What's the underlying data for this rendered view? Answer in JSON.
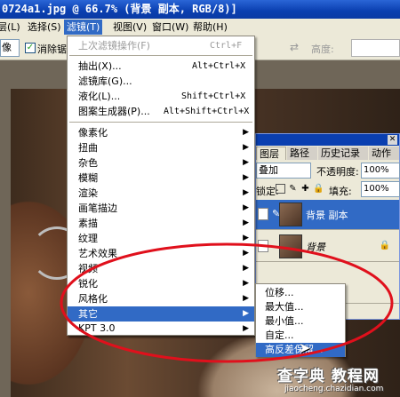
{
  "window": {
    "title": "0724a1.jpg @ 66.7% (背景 副本, RGB/8)]"
  },
  "menubar": {
    "items": [
      "层(L)",
      "选择(S)",
      "滤镜(T)",
      "视图(V)",
      "窗口(W)",
      "帮助(H)"
    ],
    "active_index": 2
  },
  "options_bar": {
    "pixels_button": "像素",
    "anti_alias_label": "消除锯",
    "anti_alias_checked": "✓",
    "height_label": "高度:"
  },
  "filter_menu": {
    "last_filter": {
      "label": "上次滤镜操作(F)",
      "shortcut": "Ctrl+F"
    },
    "group1": [
      {
        "label": "抽出(X)...",
        "shortcut": "Alt+Ctrl+X"
      },
      {
        "label": "滤镜库(G)...",
        "shortcut": ""
      },
      {
        "label": "液化(L)...",
        "shortcut": "Shift+Ctrl+X"
      },
      {
        "label": "图案生成器(P)...",
        "shortcut": "Alt+Shift+Ctrl+X"
      }
    ],
    "group2": [
      "像素化",
      "扭曲",
      "杂色",
      "模糊",
      "渲染",
      "画笔描边",
      "素描",
      "纹理",
      "艺术效果",
      "视频",
      "锐化",
      "风格化",
      "其它"
    ],
    "highlighted": "其它",
    "group3": [
      "Digimarc",
      "KPT 3.0"
    ]
  },
  "submenu": {
    "items": [
      "位移...",
      "最大值...",
      "最小值...",
      "自定...",
      "高反差保留..."
    ],
    "highlighted_index": 4
  },
  "layers_panel": {
    "tabs": [
      "图层",
      "路径",
      "历史记录",
      "动作"
    ],
    "blend_mode": "叠加",
    "opacity_label": "不透明度:",
    "opacity_value": "100%",
    "lock_label": "锁定:",
    "fill_label": "填充:",
    "fill_value": "100%",
    "layers": [
      {
        "name": "背景 副本",
        "selected": true
      },
      {
        "name": "背景",
        "selected": false
      }
    ]
  },
  "watermark": {
    "line1": "查字典 教程网",
    "line2": "jiaocheng.chazidian.com"
  },
  "colors": {
    "highlight": "#316ac5",
    "titlebar": "#0a3fb0",
    "annotation": "#e0101c"
  }
}
